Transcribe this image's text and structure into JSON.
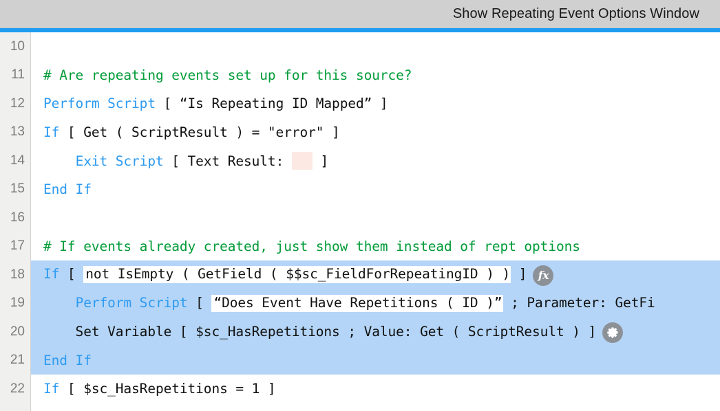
{
  "window": {
    "title": "Show Repeating Event Options Window",
    "accent_color": "#1e9cf0",
    "titlebar_color": "#d0d0d0"
  },
  "editor": {
    "gutter_color": "#f0f0ee",
    "selection_color": "#b4d5f7",
    "keyword_color": "#2e9bf0",
    "comment_color": "#009b38",
    "text_color": "#111111",
    "empty_calc_chip_color": "#fde9e4",
    "first_visible_line": 10,
    "last_visible_line": 22,
    "lines": [
      {
        "number": "10",
        "selected": false,
        "segments": []
      },
      {
        "number": "11",
        "selected": false,
        "segments": [
          {
            "kind": "comment",
            "text": "# Are repeating events set up for this source?"
          }
        ]
      },
      {
        "number": "12",
        "selected": false,
        "segments": [
          {
            "kind": "keyword",
            "text": "Perform Script"
          },
          {
            "kind": "plain",
            "text": " [ “Is Repeating ID Mapped” ]"
          }
        ]
      },
      {
        "number": "13",
        "selected": false,
        "segments": [
          {
            "kind": "keyword",
            "text": "If"
          },
          {
            "kind": "plain",
            "text": " [ Get ( ScriptResult ) = \"error\" ]"
          }
        ]
      },
      {
        "number": "14",
        "selected": false,
        "segments": [
          {
            "kind": "plain",
            "text": "    "
          },
          {
            "kind": "keyword",
            "text": "Exit Script"
          },
          {
            "kind": "plain",
            "text": " [ Text Result: "
          },
          {
            "kind": "empty-calc",
            "text": ""
          },
          {
            "kind": "plain",
            "text": " ]"
          }
        ]
      },
      {
        "number": "15",
        "selected": false,
        "segments": [
          {
            "kind": "keyword",
            "text": "End If"
          }
        ]
      },
      {
        "number": "16",
        "selected": false,
        "segments": []
      },
      {
        "number": "17",
        "selected": false,
        "segments": [
          {
            "kind": "comment",
            "text": "# If events already created, just show them instead of rept options"
          }
        ]
      },
      {
        "number": "18",
        "selected": true,
        "segments": [
          {
            "kind": "keyword",
            "text": "If"
          },
          {
            "kind": "plain",
            "text": " [ "
          },
          {
            "kind": "editbox",
            "text": "not IsEmpty ( GetField ( $$sc_FieldForRepeatingID ) )"
          },
          {
            "kind": "plain",
            "text": " ]"
          },
          {
            "kind": "fx-icon",
            "text": "fx"
          }
        ]
      },
      {
        "number": "19",
        "selected": true,
        "segments": [
          {
            "kind": "plain",
            "text": "    "
          },
          {
            "kind": "keyword",
            "text": "Perform Script"
          },
          {
            "kind": "plain",
            "text": " [ "
          },
          {
            "kind": "editbox",
            "text": "“Does Event Have Repetitions ( ID )”"
          },
          {
            "kind": "plain",
            "text": " ; Parameter: GetFi"
          }
        ]
      },
      {
        "number": "20",
        "selected": true,
        "segments": [
          {
            "kind": "plain",
            "text": "    Set Variable [ $sc_HasRepetitions ; Value: Get ( ScriptResult ) ]"
          },
          {
            "kind": "gear-icon",
            "text": "gear"
          }
        ]
      },
      {
        "number": "21",
        "selected": true,
        "segments": [
          {
            "kind": "keyword",
            "text": "End If"
          }
        ]
      },
      {
        "number": "22",
        "selected": false,
        "segments": [
          {
            "kind": "keyword",
            "text": "If"
          },
          {
            "kind": "plain",
            "text": " [ $sc_HasRepetitions = 1 ]"
          }
        ]
      }
    ]
  },
  "icons": {
    "fx_button": "fx-calculation-icon",
    "gear_button": "gear-options-icon"
  }
}
